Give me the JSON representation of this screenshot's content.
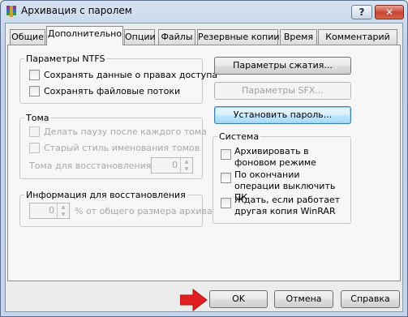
{
  "window": {
    "title": "Архивация с паролем",
    "help_button": "?",
    "close_button": "✕"
  },
  "tabs": [
    {
      "label": "Общие"
    },
    {
      "label": "Дополнительно",
      "active": true
    },
    {
      "label": "Опции"
    },
    {
      "label": "Файлы"
    },
    {
      "label": "Резервные копии"
    },
    {
      "label": "Время"
    },
    {
      "label": "Комментарий"
    }
  ],
  "ntfs": {
    "title": "Параметры NTFS",
    "save_security": "Сохранять данные о правах доступа",
    "save_streams": "Сохранять файловые потоки"
  },
  "volumes": {
    "title": "Тома",
    "pause": "Делать паузу после каждого тома",
    "old_naming": "Старый стиль именования томов",
    "recovery_label": "Тома для восстановления:",
    "recovery_value": "0"
  },
  "recovery": {
    "title": "Информация для восстановления",
    "value": "0",
    "suffix": "% от общего размера архива"
  },
  "buttons": {
    "compression": "Параметры сжатия...",
    "sfx": "Параметры SFX...",
    "set_password": "Установить пароль..."
  },
  "system": {
    "title": "Система",
    "background": "Архивировать в фоновом режиме",
    "shutdown": "По окончании операции выключить ПК",
    "wait": "Ждать, если работает другая копия WinRAR"
  },
  "footer": {
    "ok": "OK",
    "cancel": "Отмена",
    "help": "Справка"
  },
  "colors": {
    "arrow": "#e02020",
    "accent": "#3c7fb1"
  }
}
